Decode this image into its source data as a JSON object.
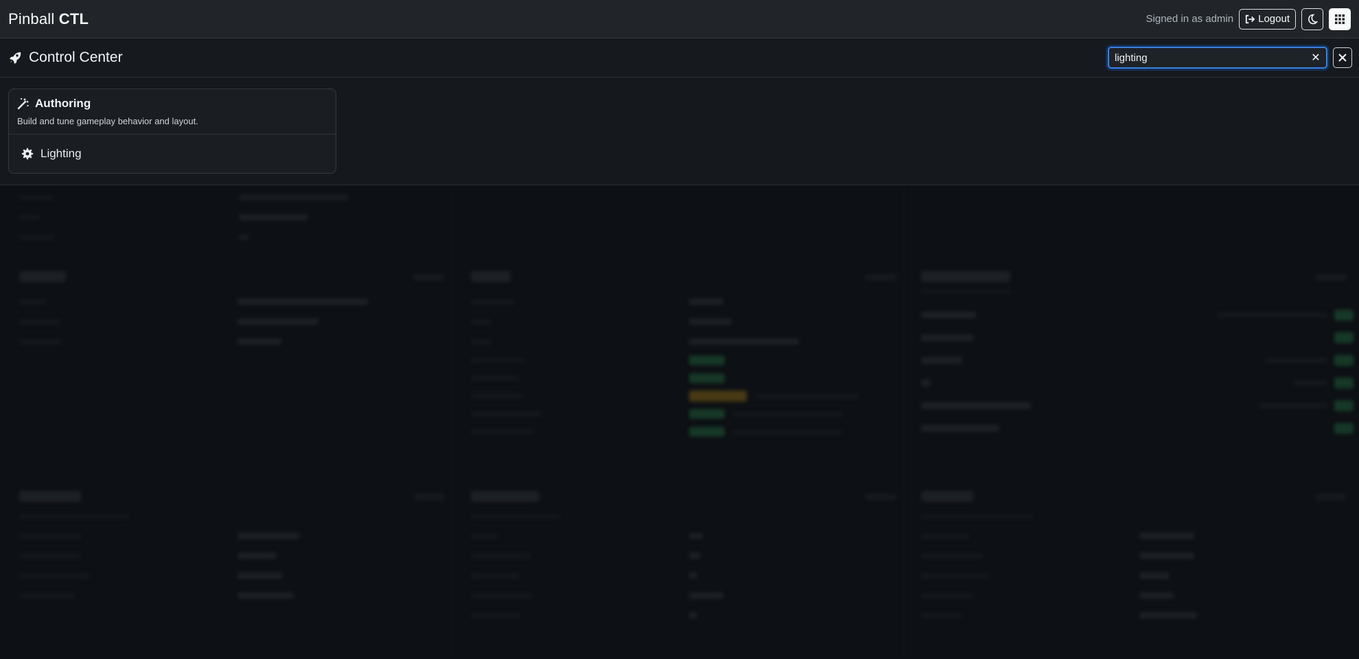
{
  "navbar": {
    "brand_light": "Pinball ",
    "brand_bold": "CTL",
    "signed_in": "Signed in as admin",
    "logout_label": "Logout"
  },
  "header": {
    "title": "Control Center"
  },
  "search": {
    "value": "lighting",
    "clear_glyph": "✕"
  },
  "results": {
    "group_title": "Authoring",
    "group_description": "Build and tune gameplay behavior and layout.",
    "items": [
      {
        "label": "Lighting"
      }
    ]
  },
  "colors": {
    "accent": "#3d7fe0",
    "success": "#1e5a37",
    "warning": "#7a5c16"
  },
  "icons": {
    "logout": "sign-out-icon",
    "theme": "moon-icon",
    "apps": "grid-icon",
    "title": "rocket-icon",
    "group": "magic-wand-icon",
    "item": "gear-icon",
    "close": "close-icon"
  }
}
